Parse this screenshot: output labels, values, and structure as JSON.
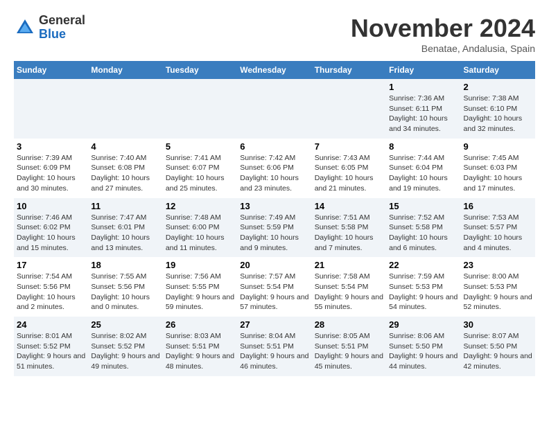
{
  "header": {
    "logo_line1": "General",
    "logo_line2": "Blue",
    "month": "November 2024",
    "location": "Benatae, Andalusia, Spain"
  },
  "weekdays": [
    "Sunday",
    "Monday",
    "Tuesday",
    "Wednesday",
    "Thursday",
    "Friday",
    "Saturday"
  ],
  "weeks": [
    [
      {
        "day": "",
        "info": ""
      },
      {
        "day": "",
        "info": ""
      },
      {
        "day": "",
        "info": ""
      },
      {
        "day": "",
        "info": ""
      },
      {
        "day": "",
        "info": ""
      },
      {
        "day": "1",
        "info": "Sunrise: 7:36 AM\nSunset: 6:11 PM\nDaylight: 10 hours and 34 minutes."
      },
      {
        "day": "2",
        "info": "Sunrise: 7:38 AM\nSunset: 6:10 PM\nDaylight: 10 hours and 32 minutes."
      }
    ],
    [
      {
        "day": "3",
        "info": "Sunrise: 7:39 AM\nSunset: 6:09 PM\nDaylight: 10 hours and 30 minutes."
      },
      {
        "day": "4",
        "info": "Sunrise: 7:40 AM\nSunset: 6:08 PM\nDaylight: 10 hours and 27 minutes."
      },
      {
        "day": "5",
        "info": "Sunrise: 7:41 AM\nSunset: 6:07 PM\nDaylight: 10 hours and 25 minutes."
      },
      {
        "day": "6",
        "info": "Sunrise: 7:42 AM\nSunset: 6:06 PM\nDaylight: 10 hours and 23 minutes."
      },
      {
        "day": "7",
        "info": "Sunrise: 7:43 AM\nSunset: 6:05 PM\nDaylight: 10 hours and 21 minutes."
      },
      {
        "day": "8",
        "info": "Sunrise: 7:44 AM\nSunset: 6:04 PM\nDaylight: 10 hours and 19 minutes."
      },
      {
        "day": "9",
        "info": "Sunrise: 7:45 AM\nSunset: 6:03 PM\nDaylight: 10 hours and 17 minutes."
      }
    ],
    [
      {
        "day": "10",
        "info": "Sunrise: 7:46 AM\nSunset: 6:02 PM\nDaylight: 10 hours and 15 minutes."
      },
      {
        "day": "11",
        "info": "Sunrise: 7:47 AM\nSunset: 6:01 PM\nDaylight: 10 hours and 13 minutes."
      },
      {
        "day": "12",
        "info": "Sunrise: 7:48 AM\nSunset: 6:00 PM\nDaylight: 10 hours and 11 minutes."
      },
      {
        "day": "13",
        "info": "Sunrise: 7:49 AM\nSunset: 5:59 PM\nDaylight: 10 hours and 9 minutes."
      },
      {
        "day": "14",
        "info": "Sunrise: 7:51 AM\nSunset: 5:58 PM\nDaylight: 10 hours and 7 minutes."
      },
      {
        "day": "15",
        "info": "Sunrise: 7:52 AM\nSunset: 5:58 PM\nDaylight: 10 hours and 6 minutes."
      },
      {
        "day": "16",
        "info": "Sunrise: 7:53 AM\nSunset: 5:57 PM\nDaylight: 10 hours and 4 minutes."
      }
    ],
    [
      {
        "day": "17",
        "info": "Sunrise: 7:54 AM\nSunset: 5:56 PM\nDaylight: 10 hours and 2 minutes."
      },
      {
        "day": "18",
        "info": "Sunrise: 7:55 AM\nSunset: 5:56 PM\nDaylight: 10 hours and 0 minutes."
      },
      {
        "day": "19",
        "info": "Sunrise: 7:56 AM\nSunset: 5:55 PM\nDaylight: 9 hours and 59 minutes."
      },
      {
        "day": "20",
        "info": "Sunrise: 7:57 AM\nSunset: 5:54 PM\nDaylight: 9 hours and 57 minutes."
      },
      {
        "day": "21",
        "info": "Sunrise: 7:58 AM\nSunset: 5:54 PM\nDaylight: 9 hours and 55 minutes."
      },
      {
        "day": "22",
        "info": "Sunrise: 7:59 AM\nSunset: 5:53 PM\nDaylight: 9 hours and 54 minutes."
      },
      {
        "day": "23",
        "info": "Sunrise: 8:00 AM\nSunset: 5:53 PM\nDaylight: 9 hours and 52 minutes."
      }
    ],
    [
      {
        "day": "24",
        "info": "Sunrise: 8:01 AM\nSunset: 5:52 PM\nDaylight: 9 hours and 51 minutes."
      },
      {
        "day": "25",
        "info": "Sunrise: 8:02 AM\nSunset: 5:52 PM\nDaylight: 9 hours and 49 minutes."
      },
      {
        "day": "26",
        "info": "Sunrise: 8:03 AM\nSunset: 5:51 PM\nDaylight: 9 hours and 48 minutes."
      },
      {
        "day": "27",
        "info": "Sunrise: 8:04 AM\nSunset: 5:51 PM\nDaylight: 9 hours and 46 minutes."
      },
      {
        "day": "28",
        "info": "Sunrise: 8:05 AM\nSunset: 5:51 PM\nDaylight: 9 hours and 45 minutes."
      },
      {
        "day": "29",
        "info": "Sunrise: 8:06 AM\nSunset: 5:50 PM\nDaylight: 9 hours and 44 minutes."
      },
      {
        "day": "30",
        "info": "Sunrise: 8:07 AM\nSunset: 5:50 PM\nDaylight: 9 hours and 42 minutes."
      }
    ]
  ]
}
